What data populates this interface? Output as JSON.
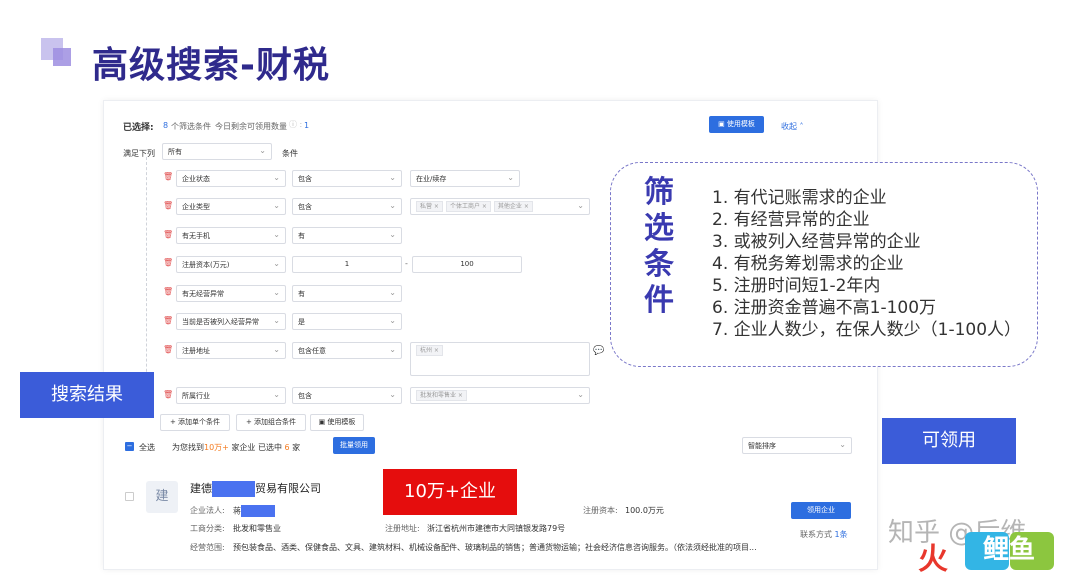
{
  "slide": {
    "title": "高级搜索-财税"
  },
  "filter_panel": {
    "selected_label": "已选择:",
    "selected_count_prefix": "8",
    "selected_count_suffix": "个筛选条件",
    "quota_label": "今日剩余可领用数量",
    "quota_value": "1",
    "use_template_label": "使用模板",
    "collapse_label": "收起",
    "match_label": "满足下列",
    "match_value": "所有",
    "condition_label": "条件",
    "rows": [
      {
        "field": "企业状态",
        "op": "包含",
        "value": "在业/续存"
      },
      {
        "field": "企业类型",
        "op": "包含",
        "tags": [
          "私营",
          "个体工商户",
          "其他企业"
        ]
      },
      {
        "field": "有无手机",
        "op": "有"
      },
      {
        "field": "注册资本(万元)",
        "min": "1",
        "sep": "-",
        "max": "100"
      },
      {
        "field": "有无经营异常",
        "op": "有"
      },
      {
        "field": "当前是否被列入经营异常",
        "op": "是"
      },
      {
        "field": "注册地址",
        "op": "包含任意",
        "tags": [
          "杭州"
        ]
      },
      {
        "field": "所属行业",
        "op": "包含",
        "tags": [
          "批发和零售业"
        ]
      }
    ],
    "add_single_label": "添加单个条件",
    "add_group_label": "添加组合条件",
    "use_template_bottom_label": "使用模板"
  },
  "results": {
    "select_all_label": "全选",
    "found_prefix": "为您找到",
    "found_count": "10万+",
    "found_suffix": "家企业",
    "selected_prefix": "已选中",
    "selected_count": "6",
    "selected_suffix": "家",
    "batch_claim_label": "批量领用",
    "sort_value": "智能排序",
    "company": {
      "avatar_char": "建",
      "name_start": "建德",
      "name_end": "贸易有限公司",
      "legal_label": "企业法人:",
      "legal_value": "蒋",
      "capital_label": "注册资本:",
      "capital_value": "100.0万元",
      "industry_label": "工商分类:",
      "industry_value": "批发和零售业",
      "address_label": "注册地址:",
      "address_value": "浙江省杭州市建德市大同镇银发路79号",
      "scope_label": "经营范围:",
      "scope_value": "预包装食品、酒类、保健食品、文具、建筑材料、机械设备配件、玻璃制品的销售；普通货物运输；社会经济信息咨询服务。（依法须经批准的项目...",
      "claim_label": "领用企业",
      "contact_label": "联系方式",
      "contact_value": "1条"
    }
  },
  "overlays": {
    "filter_heading": "筛选条件",
    "conditions": [
      "1. 有代记账需求的企业",
      "2. 有经营异常的企业",
      "3. 或被列入经营异常的企业",
      "4. 有税务筹划需求的企业",
      "5. 注册时间短1-2年内",
      "6. 注册资金普遍不高1-100万",
      "7. 企业人数少，在保人数少（1-100人）"
    ],
    "search_results_label": "搜索结果",
    "claimable_label": "可领用",
    "count_badge": "10万+企业"
  },
  "watermark": {
    "text": "知乎 @后维",
    "logo_left": "火",
    "logo_right": "鲤鱼"
  },
  "colors": {
    "title": "#2f2a8c",
    "accent_blue": "#2d6ee0",
    "overlay_blue": "#3b5cd9",
    "badge_red": "#e50d0d",
    "highlight_orange": "#f47b20"
  }
}
